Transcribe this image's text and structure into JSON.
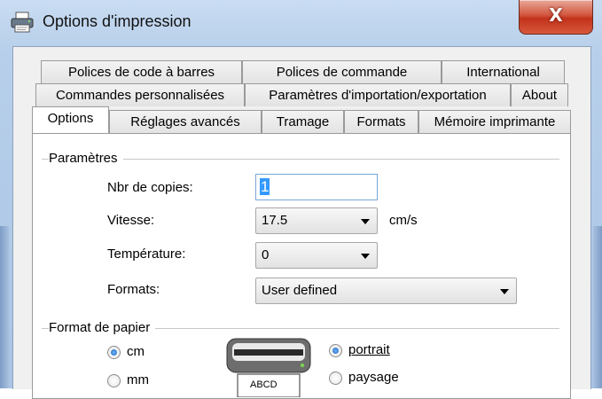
{
  "window": {
    "title": "Options d'impression",
    "close_glyph": "X"
  },
  "tabs": {
    "row1": [
      "Polices de code à barres",
      "Polices de commande",
      "International"
    ],
    "row2": [
      "Commandes personnalisées",
      "Paramètres d'importation/exportation",
      "About"
    ],
    "row3": [
      "Options",
      "Réglages avancés",
      "Tramage",
      "Formats",
      "Mémoire imprimante"
    ],
    "active": "Options"
  },
  "parametres": {
    "group_label": "Paramètres",
    "copies_label": "Nbr de copies:",
    "copies_value": "1",
    "vitesse_label": "Vitesse:",
    "vitesse_value": "17.5",
    "vitesse_unit": "cm/s",
    "temperature_label": "Température:",
    "temperature_value": "0",
    "formats_label": "Formats:",
    "formats_value": "User defined"
  },
  "format_papier": {
    "group_label": "Format de papier",
    "unit_cm": "cm",
    "unit_mm": "mm",
    "unit_selected": "cm",
    "printer_image_text": "ABCD",
    "orient_portrait": "portrait",
    "orient_paysage": "paysage",
    "orient_selected": "portrait"
  },
  "colors": {
    "accent_selection": "#3399ff",
    "close_button": "#c2321b"
  },
  "icons": {
    "app": "printer-icon",
    "close": "close-icon",
    "dropdown": "chevron-down-icon"
  }
}
